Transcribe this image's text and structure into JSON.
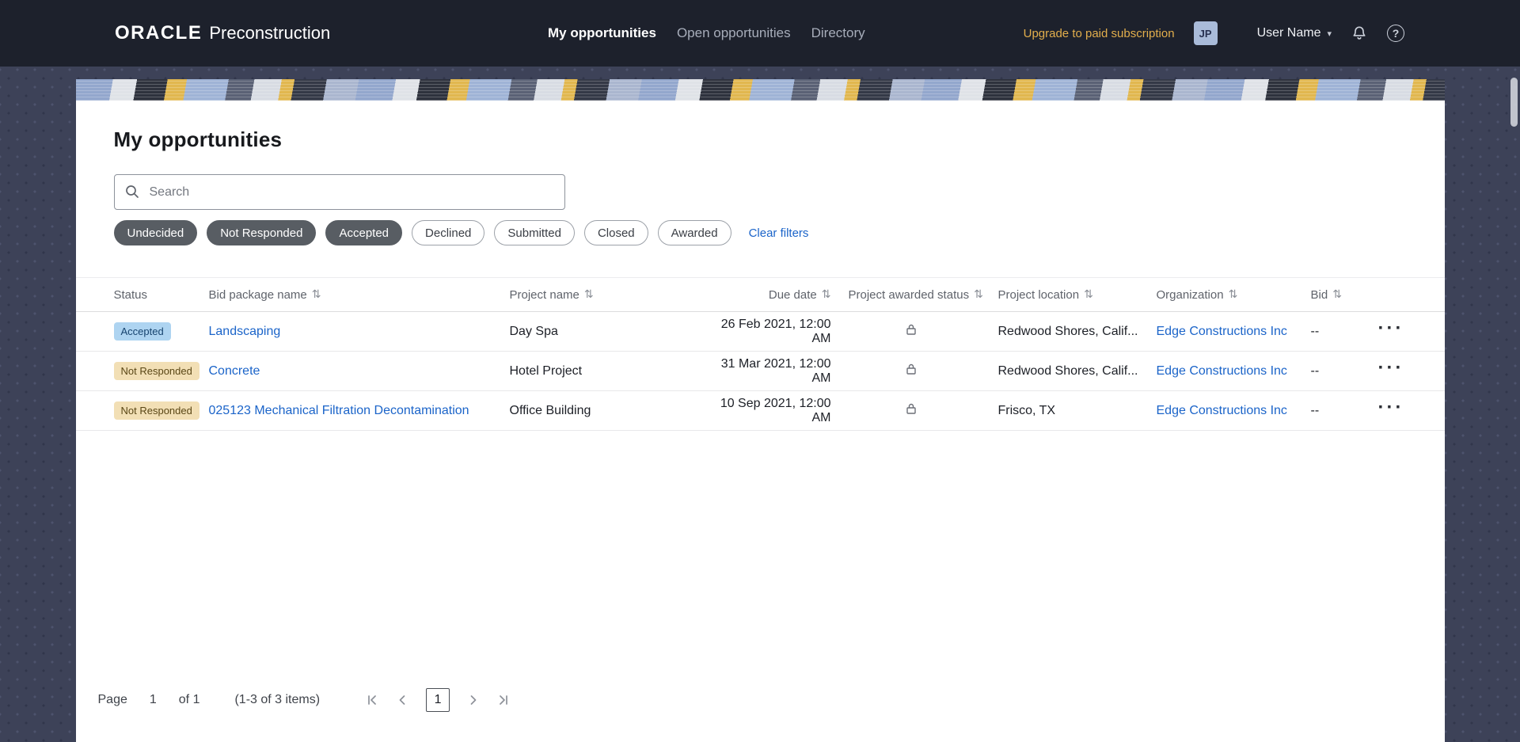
{
  "header": {
    "brand": {
      "oracle": "ORACLE",
      "product": "Preconstruction"
    },
    "nav": [
      {
        "label": "My opportunities",
        "active": true
      },
      {
        "label": "Open opportunities",
        "active": false
      },
      {
        "label": "Directory",
        "active": false
      }
    ],
    "upgrade_link": "Upgrade to paid subscription",
    "avatar_initials": "JP",
    "user_menu": "User Name"
  },
  "page": {
    "title": "My opportunities",
    "search": {
      "placeholder": "Search",
      "value": ""
    },
    "filters": {
      "chips": [
        {
          "label": "Undecided",
          "selected": true
        },
        {
          "label": "Not Responded",
          "selected": true
        },
        {
          "label": "Accepted",
          "selected": true
        },
        {
          "label": "Declined",
          "selected": false
        },
        {
          "label": "Submitted",
          "selected": false
        },
        {
          "label": "Closed",
          "selected": false
        },
        {
          "label": "Awarded",
          "selected": false
        }
      ],
      "clear_label": "Clear filters"
    }
  },
  "table": {
    "columns": [
      "Status",
      "Bid package name",
      "Project name",
      "Due date",
      "Project awarded status",
      "Project location",
      "Organization",
      "Bid"
    ],
    "rows": [
      {
        "status": "Accepted",
        "status_kind": "accepted",
        "bid_package": "Landscaping",
        "project_name": "Day Spa",
        "due_date": "26 Feb 2021, 12:00 AM",
        "project_location": "Redwood Shores, Calif...",
        "organization": "Edge Constructions Inc",
        "bid": "--"
      },
      {
        "status": "Not Responded",
        "status_kind": "not-responded",
        "bid_package": "Concrete",
        "project_name": "Hotel Project",
        "due_date": "31 Mar 2021, 12:00 AM",
        "project_location": "Redwood Shores, Calif...",
        "organization": "Edge Constructions Inc",
        "bid": "--"
      },
      {
        "status": "Not Responded",
        "status_kind": "not-responded",
        "bid_package": "025123 Mechanical Filtration Decontamination",
        "project_name": "Office Building",
        "due_date": "10 Sep 2021, 12:00 AM",
        "project_location": "Frisco, TX",
        "organization": "Edge Constructions Inc",
        "bid": "--"
      }
    ]
  },
  "pagination": {
    "page_label": "Page",
    "current_page": "1",
    "of_label": "of 1",
    "items_summary": "(1-3 of 3 items)",
    "current_page_button": "1"
  },
  "icons": {
    "sort": "⇅",
    "caret": "▾",
    "actions": "···",
    "help_glyph": "?"
  },
  "colors": {
    "header_bg": "#1d212c",
    "page_bg": "#3d4258",
    "link_blue": "#1b64c9",
    "upgrade_gold": "#e2ae4c",
    "chip_selected_bg": "#585d63",
    "badge_accepted_bg": "#aed4f1",
    "badge_not_responded_bg": "#f2dfb5"
  }
}
